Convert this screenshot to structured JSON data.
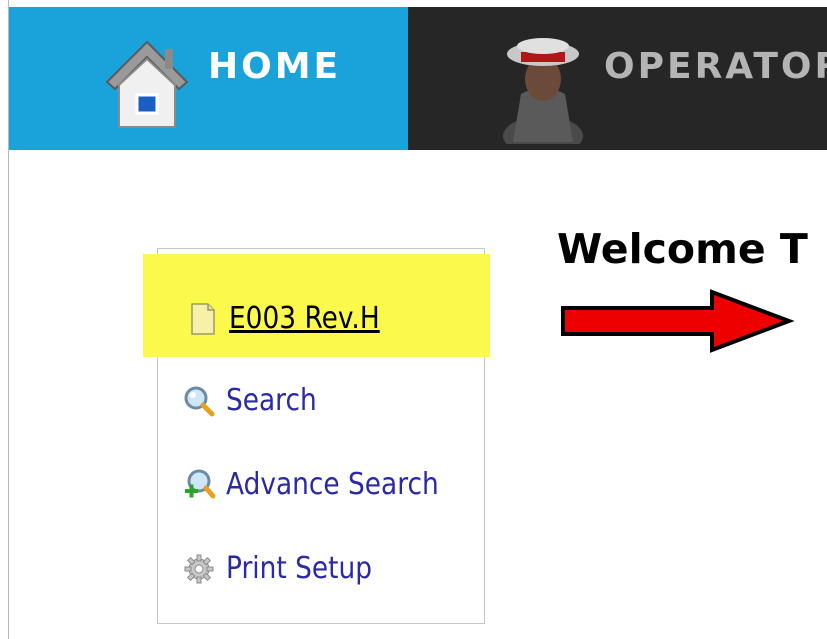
{
  "nav": {
    "home_label": "HOME",
    "home_icon": "house-icon",
    "operator_label": "OPERATOR",
    "operator_icon": "operator-avatar-icon",
    "home_color": "#1aa3da",
    "bar_color": "#262626"
  },
  "main": {
    "welcome": "Welcome T",
    "arrow_color": "#ee0000"
  },
  "menu": {
    "highlight_color": "#fbfa4c",
    "items": [
      {
        "label": "E003 Rev.H",
        "icon": "document-icon"
      },
      {
        "label": "Search",
        "icon": "search-icon"
      },
      {
        "label": "Advance Search",
        "icon": "advance-search-icon"
      },
      {
        "label": "Print Setup",
        "icon": "gear-icon"
      }
    ]
  }
}
